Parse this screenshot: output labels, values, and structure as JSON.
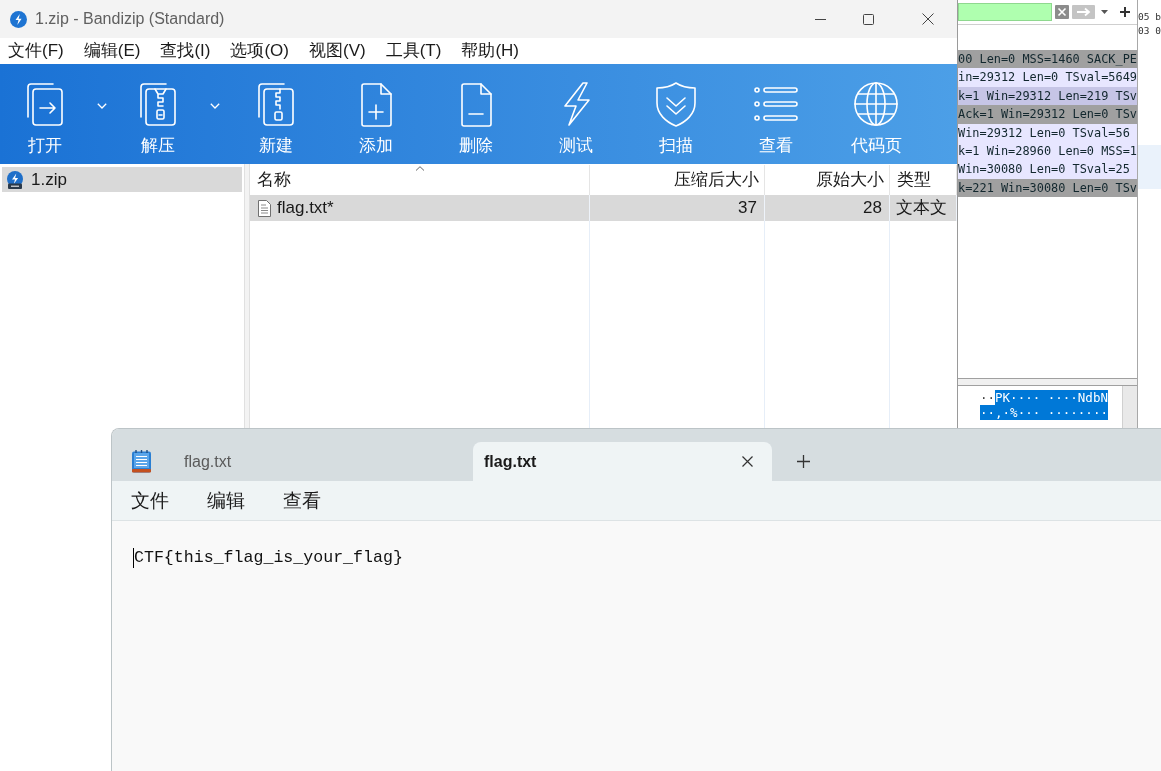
{
  "packet_analyzer": {
    "bytes_column": [
      "05 b",
      "03 0"
    ],
    "packet_rows": [
      {
        "text": "00 Len=0 MSS=1460 SACK_PE",
        "color": "#a0a0a0"
      },
      {
        "text": "in=29312 Len=0 TSval=5649",
        "color": "#e7e6ff"
      },
      {
        "text": "k=1 Win=29312 Len=219 TSv",
        "color": "#c6c5e6"
      },
      {
        "text": "Ack=1 Win=29312 Len=0 TSv",
        "color": "#a0a0a0"
      },
      {
        "text": "Win=29312 Len=0 TSval=56",
        "color": "#e7e6ff"
      },
      {
        "text": "k=1 Win=28960 Len=0 MSS=1",
        "color": "#e7e6ff"
      },
      {
        "text": "Win=30080 Len=0 TSval=25",
        "color": "#e7e6ff"
      },
      {
        "text": "k=221 Win=30080 Len=0 TSv",
        "color": "#a0a0a0"
      }
    ],
    "ascii_dump": [
      [
        {
          "text": "··",
          "selected": false
        },
        {
          "text": "PK···· ····NdbN",
          "selected": true
        }
      ],
      [
        {
          "text": "··,·%··· ········",
          "selected": true
        }
      ]
    ]
  },
  "bandizip": {
    "title": "1.zip - Bandizip (Standard)",
    "menu": [
      "文件(F)",
      "编辑(E)",
      "查找(I)",
      "选项(O)",
      "视图(V)",
      "工具(T)",
      "帮助(H)"
    ],
    "toolbar": [
      {
        "label": "打开",
        "dropdown": true
      },
      {
        "label": "解压",
        "dropdown": true
      },
      {
        "label": "新建",
        "dropdown": false
      },
      {
        "label": "添加",
        "dropdown": false
      },
      {
        "label": "删除",
        "dropdown": false
      },
      {
        "label": "测试",
        "dropdown": false
      },
      {
        "label": "扫描",
        "dropdown": false
      },
      {
        "label": "查看",
        "dropdown": false
      },
      {
        "label": "代码页",
        "dropdown": false
      }
    ],
    "tree": [
      {
        "label": "1.zip",
        "selected": true
      }
    ],
    "file_list": {
      "columns": [
        {
          "label": "名称",
          "sorted": true
        },
        {
          "label": "压缩后大小",
          "sorted": false
        },
        {
          "label": "原始大小",
          "sorted": false
        },
        {
          "label": "类型",
          "sorted": false
        }
      ],
      "rows": [
        {
          "cells": [
            "flag.txt*",
            "37",
            "28",
            "文本文"
          ],
          "selected": true
        }
      ]
    }
  },
  "notepad": {
    "tabs": [
      {
        "label": "flag.txt",
        "selected": false
      },
      {
        "label": "flag.txt",
        "selected": true
      }
    ],
    "menu": [
      "文件",
      "编辑",
      "查看"
    ],
    "content": "CTF{this_flag_is_your_flag}"
  }
}
